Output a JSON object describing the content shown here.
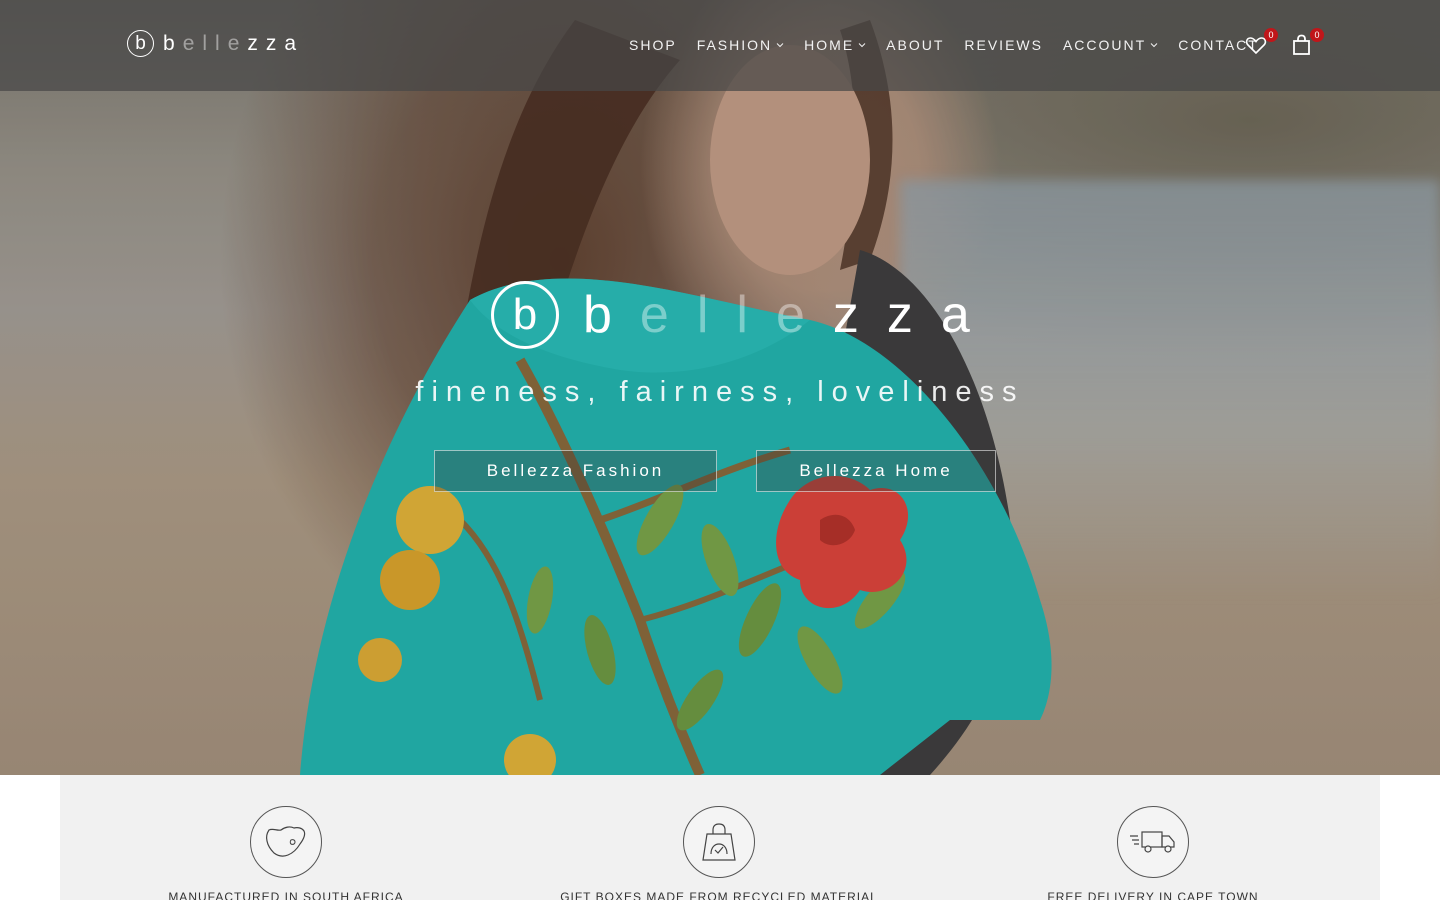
{
  "brand": {
    "logo_mark": "b",
    "wordmark_parts": [
      "b",
      "elle",
      "zza"
    ]
  },
  "nav": {
    "items": [
      {
        "label": "SHOP",
        "has_dropdown": false
      },
      {
        "label": "FASHION",
        "has_dropdown": true
      },
      {
        "label": "HOME",
        "has_dropdown": true
      },
      {
        "label": "ABOUT",
        "has_dropdown": false
      },
      {
        "label": "REVIEWS",
        "has_dropdown": false
      },
      {
        "label": "ACCOUNT",
        "has_dropdown": true
      },
      {
        "label": "CONTACT",
        "has_dropdown": false
      }
    ],
    "wishlist": {
      "icon": "heart-icon",
      "count": "0"
    },
    "cart": {
      "icon": "shopping-bag-icon",
      "count": "0"
    }
  },
  "hero": {
    "tagline": "fineness, fairness, loveliness",
    "buttons": [
      {
        "label": "Bellezza Fashion"
      },
      {
        "label": "Bellezza Home"
      }
    ]
  },
  "features": [
    {
      "icon": "south-africa-map-icon",
      "label": "MANUFACTURED IN SOUTH AFRICA"
    },
    {
      "icon": "recycled-gift-bag-icon",
      "label": "GIFT BOXES MADE FROM RECYCLED MATERIAL"
    },
    {
      "icon": "delivery-truck-icon",
      "label": "FREE DELIVERY IN CAPE TOWN"
    }
  ],
  "colors": {
    "badge": "#c0161a",
    "navbar": "#464646",
    "scarf": "#1fb9b4",
    "features_bg": "#f1f1f1"
  }
}
